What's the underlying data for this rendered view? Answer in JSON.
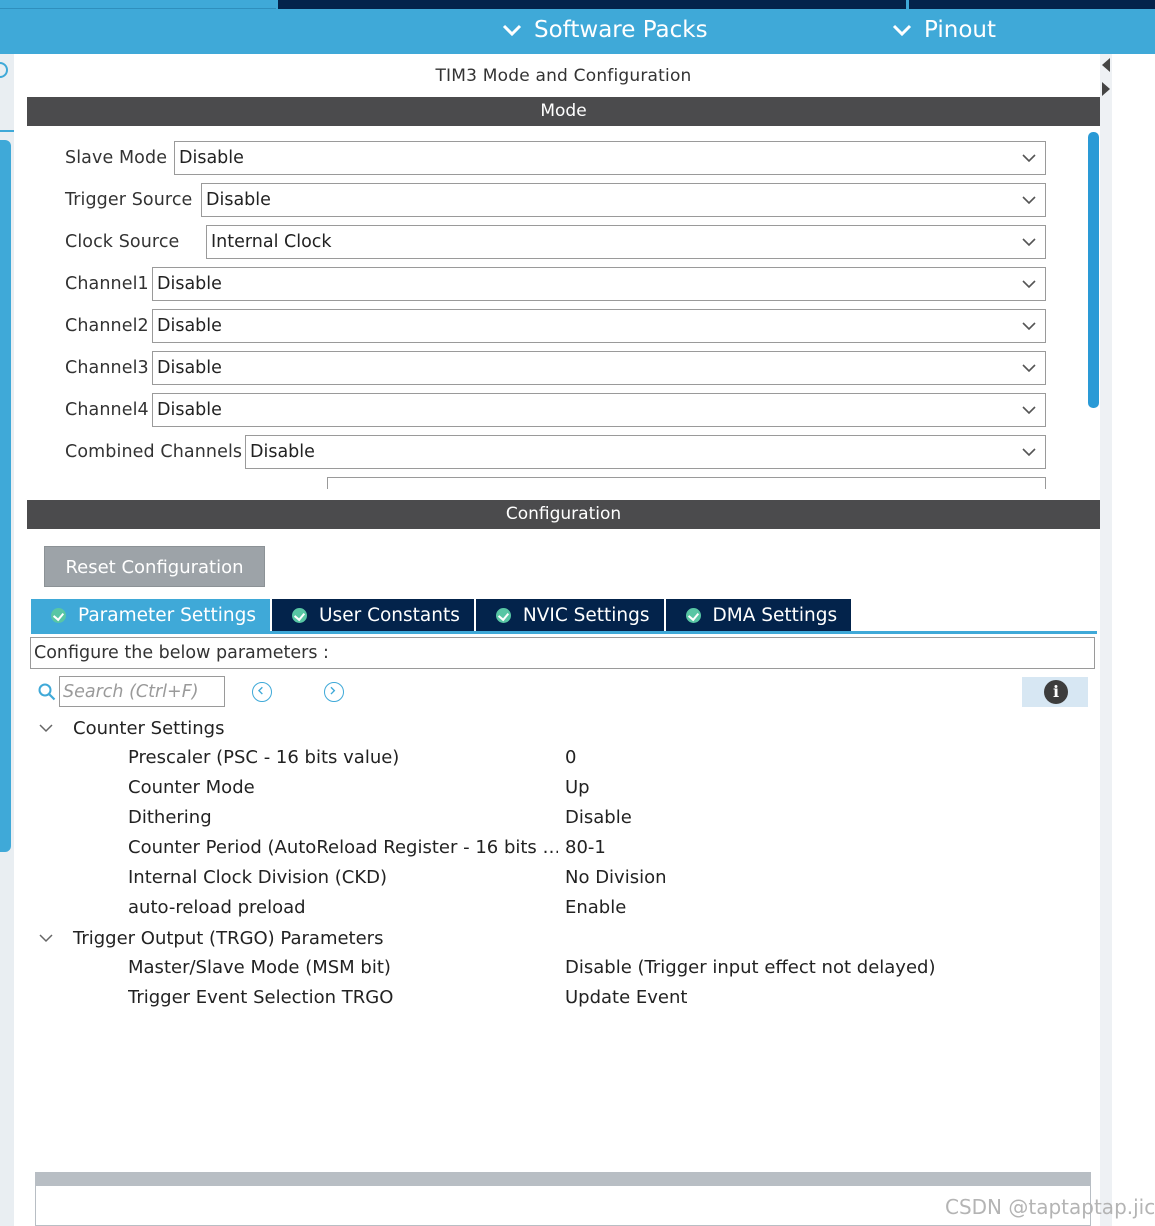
{
  "header": {
    "menu": [
      {
        "label": "Software Packs",
        "icon": "chevron-down-icon"
      },
      {
        "label": "Pinout",
        "icon": "chevron-down-icon"
      }
    ]
  },
  "panel": {
    "title": "TIM3 Mode and Configuration"
  },
  "mode": {
    "header": "Mode",
    "rows": [
      {
        "label": "Slave Mode",
        "value": "Disable"
      },
      {
        "label": "Trigger Source",
        "value": "Disable"
      },
      {
        "label": "Clock Source",
        "value": "Internal Clock"
      },
      {
        "label": "Channel1",
        "value": "Disable"
      },
      {
        "label": "Channel2",
        "value": "Disable"
      },
      {
        "label": "Channel3",
        "value": "Disable"
      },
      {
        "label": "Channel4",
        "value": "Disable"
      },
      {
        "label": "Combined Channels",
        "value": "Disable"
      }
    ]
  },
  "configuration": {
    "header": "Configuration",
    "reset_label": "Reset Configuration",
    "tabs": [
      {
        "label": "Parameter Settings",
        "active": true
      },
      {
        "label": "User Constants",
        "active": false
      },
      {
        "label": "NVIC Settings",
        "active": false
      },
      {
        "label": "DMA Settings",
        "active": false
      }
    ],
    "hint": "Configure the below parameters :",
    "search_placeholder": "Search (Ctrl+F)",
    "groups": [
      {
        "title": "Counter Settings",
        "params": [
          {
            "name": "Prescaler (PSC - 16 bits value)",
            "value": "0"
          },
          {
            "name": "Counter Mode",
            "value": "Up"
          },
          {
            "name": "Dithering",
            "value": "Disable"
          },
          {
            "name": "Counter Period (AutoReload Register - 16 bits …",
            "value": "80-1"
          },
          {
            "name": "Internal Clock Division (CKD)",
            "value": "No Division"
          },
          {
            "name": "auto-reload preload",
            "value": "Enable"
          }
        ]
      },
      {
        "title": "Trigger Output (TRGO) Parameters",
        "params": [
          {
            "name": "Master/Slave Mode (MSM bit)",
            "value": "Disable (Trigger input effect not delayed)"
          },
          {
            "name": "Trigger Event Selection TRGO",
            "value": "Update Event"
          }
        ]
      }
    ]
  },
  "watermark": "CSDN @taptaptap.jic",
  "colors": {
    "accent": "#3fa9d8",
    "navy": "#03234b",
    "section_bar": "#4b4b4d",
    "reset_button": "#9da3a8",
    "check": "#58c6a4"
  }
}
